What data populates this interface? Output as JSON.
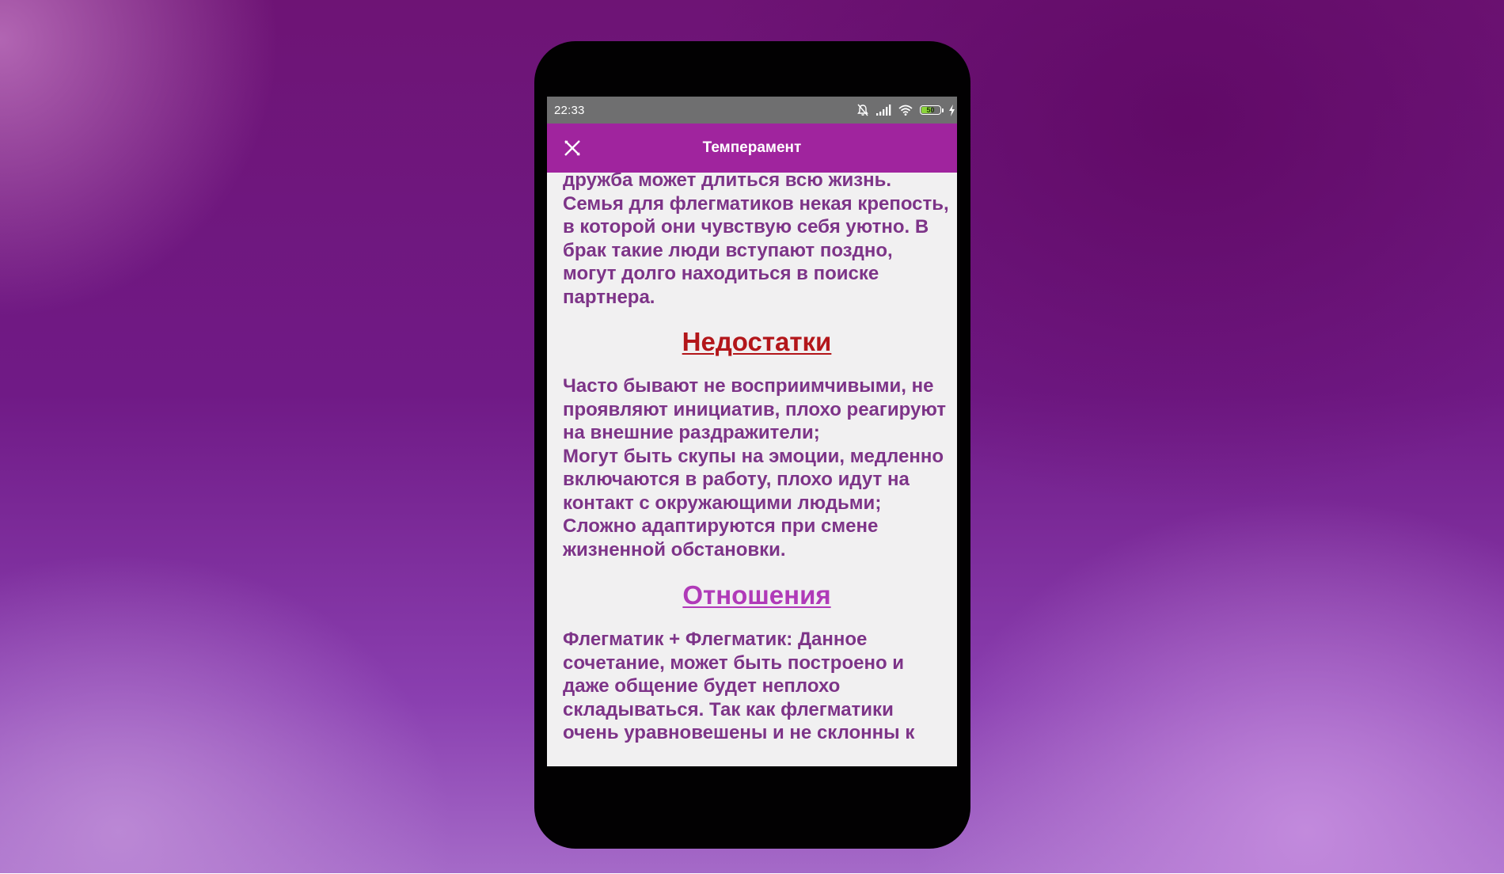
{
  "status_bar": {
    "time": "22:33",
    "battery_level": "50",
    "battery_fraction": 0.5,
    "icons": [
      "bell-off-icon",
      "signal-icon",
      "wifi-icon",
      "battery-icon",
      "charging-icon"
    ]
  },
  "app_bar": {
    "title": "Темперамент",
    "close_icon": "close-icon",
    "color": "#a0249e"
  },
  "content": {
    "intro_paragraph": "дружба может длиться всю жизнь.\nСемья для флегматиков некая крепость, в которой они чувствую себя уютно. В брак такие люди вступают поздно, могут долго находиться в поиске партнера.",
    "section_disadvantages": {
      "heading": "Недостатки",
      "heading_color": "#b3161a",
      "text": "Часто бывают не восприимчивыми, не проявляют инициатив, плохо реагируют на внешние раздражители;\nМогут быть скупы на эмоции, медленно включаются в работу, плохо идут на контакт с окружающими людьми;\nСложно адаптируются при смене жизненной обстановки."
    },
    "section_relations": {
      "heading": "Отношения",
      "heading_color": "#b03ab8",
      "text": "Флегматик + Флегматик: Данное сочетание, может быть построено и даже общение будет неплохо складываться. Так как флегматики очень уравновешены и не склонны к"
    },
    "text_color": "#7d3488"
  }
}
